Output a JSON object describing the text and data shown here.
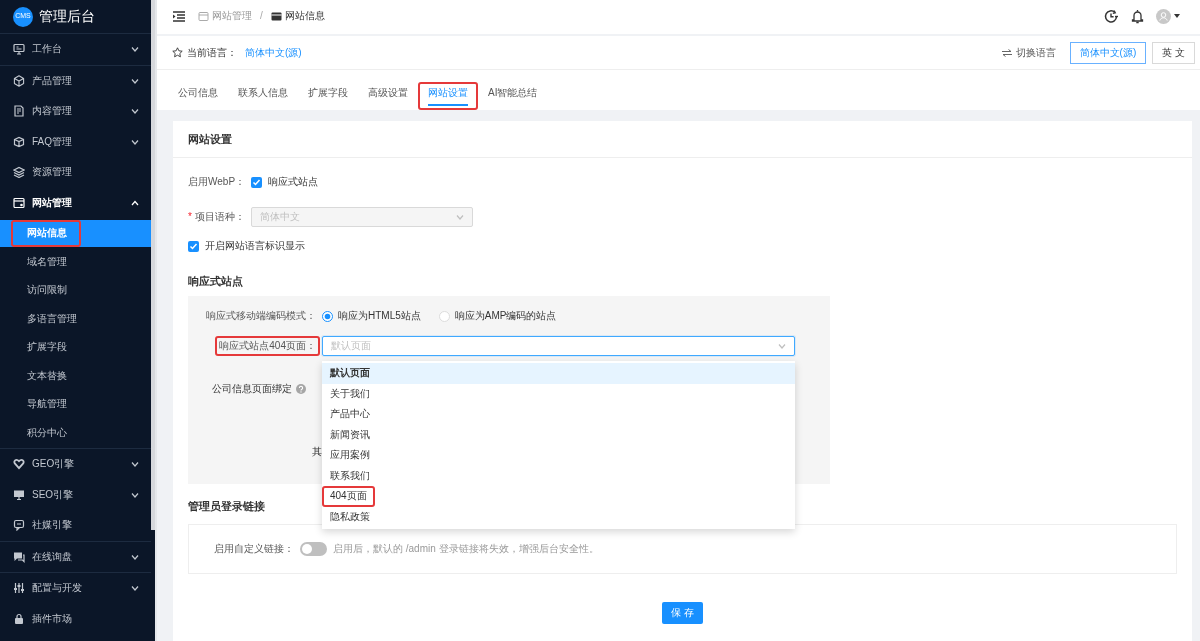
{
  "sidebar": {
    "logo": {
      "badge": "CMS",
      "title": "管理后台"
    },
    "sections": [
      [
        {
          "label": "工作台",
          "kind": "submenu",
          "expanded": false
        }
      ],
      [
        {
          "label": "产品管理",
          "kind": "submenu",
          "expanded": false
        },
        {
          "label": "内容管理",
          "kind": "submenu",
          "expanded": false
        },
        {
          "label": "FAQ管理",
          "kind": "submenu",
          "expanded": false
        },
        {
          "label": "资源管理",
          "kind": "link"
        },
        {
          "label": "网站管理",
          "kind": "submenu",
          "expanded": true,
          "children": [
            {
              "label": "网站信息",
              "selected": true,
              "highlighted": true
            },
            {
              "label": "域名管理",
              "selected": false,
              "highlighted": false
            },
            {
              "label": "访问限制",
              "selected": false,
              "highlighted": false
            },
            {
              "label": "多语言管理",
              "selected": false,
              "highlighted": false
            },
            {
              "label": "扩展字段",
              "selected": false,
              "highlighted": false
            },
            {
              "label": "文本替换",
              "selected": false,
              "highlighted": false
            },
            {
              "label": "导航管理",
              "selected": false,
              "highlighted": false
            },
            {
              "label": "积分中心",
              "selected": false,
              "highlighted": false
            }
          ]
        }
      ],
      [
        {
          "label": "GEO引擎",
          "kind": "submenu",
          "expanded": false
        },
        {
          "label": "SEO引擎",
          "kind": "submenu",
          "expanded": false
        },
        {
          "label": "社媒引擎",
          "kind": "link"
        }
      ],
      [
        {
          "label": "在线询盘",
          "kind": "submenu",
          "expanded": false
        }
      ],
      [
        {
          "label": "配置与开发",
          "kind": "submenu",
          "expanded": false
        },
        {
          "label": "插件市场",
          "kind": "link"
        }
      ]
    ]
  },
  "header": {
    "breadcrumb": [
      {
        "label": "网站管理",
        "current": false
      },
      {
        "label": "网站信息",
        "current": true
      }
    ],
    "separator": "/"
  },
  "language_bar": {
    "label": "当前语言：",
    "current": "简体中文(源)",
    "switch_label": "切换语言",
    "buttons": [
      {
        "label": "简体中文(源)",
        "selected": true
      },
      {
        "label": "英 文",
        "selected": false
      }
    ]
  },
  "tabs": [
    {
      "label": "公司信息",
      "selected": false,
      "highlighted": false
    },
    {
      "label": "联系人信息",
      "selected": false,
      "highlighted": false
    },
    {
      "label": "扩展字段",
      "selected": false,
      "highlighted": false
    },
    {
      "label": "高级设置",
      "selected": false,
      "highlighted": false
    },
    {
      "label": "网站设置",
      "selected": true,
      "highlighted": true
    },
    {
      "label": "AI智能总结",
      "selected": false,
      "highlighted": false
    }
  ],
  "card": {
    "title": "网站设置",
    "webp": {
      "label": "启用WebP：",
      "option": "响应式站点",
      "checked": true
    },
    "project_language": {
      "required_mark": "*",
      "label": "项目语种：",
      "value": "简体中文",
      "disabled": true
    },
    "language_tag": {
      "label": "开启网站语言标识显示",
      "checked": true
    },
    "responsive": {
      "title": "响应式站点",
      "rows": [
        {
          "kind": "radio",
          "label": "响应式移动端编码模式：",
          "options": [
            {
              "label": "响应为HTML5站点",
              "selected": true
            },
            {
              "label": "响应为AMP编码的站点",
              "selected": false
            }
          ]
        },
        {
          "kind": "select",
          "label": "响应式站点404页面：",
          "highlighted": true,
          "placeholder": "默认页面",
          "expanded": true,
          "options": [
            {
              "label": "默认页面",
              "selected": true,
              "highlighted": false
            },
            {
              "label": "关于我们",
              "selected": false,
              "highlighted": false
            },
            {
              "label": "产品中心",
              "selected": false,
              "highlighted": false
            },
            {
              "label": "新闻资讯",
              "selected": false,
              "highlighted": false
            },
            {
              "label": "应用案例",
              "selected": false,
              "highlighted": false
            },
            {
              "label": "联系我们",
              "selected": false,
              "highlighted": false
            },
            {
              "label": "404页面",
              "selected": false,
              "highlighted": true
            },
            {
              "label": "隐私政策",
              "selected": false,
              "highlighted": false
            }
          ]
        },
        {
          "kind": "help",
          "label": "公司信息页面绑定"
        },
        {
          "kind": "text",
          "label": "其"
        }
      ]
    },
    "admin_link": {
      "title": "管理员登录链接",
      "label": "启用自定义链接：",
      "on": false,
      "hint": "启用后，默认的 /admin 登录链接将失效，增强后台安全性。"
    },
    "save": "保 存"
  }
}
